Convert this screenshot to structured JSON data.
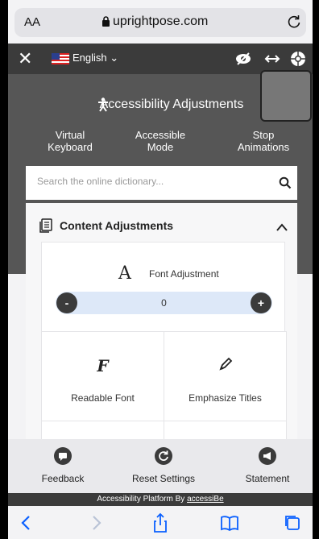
{
  "browser": {
    "text_size_label": "AA",
    "url": "uprightpose.com"
  },
  "widget_header": {
    "language": "English"
  },
  "panel": {
    "title": "Accessibility Adjustments",
    "quick_actions": [
      {
        "label": "Virtual Keyboard"
      },
      {
        "label": "Accessible Mode"
      },
      {
        "label": "Stop Animations"
      }
    ]
  },
  "search": {
    "placeholder": "Search the online dictionary..."
  },
  "content_adjustments": {
    "title": "Content Adjustments",
    "font_adjustment": {
      "label": "Font Adjustment",
      "value": "0",
      "minus_label": "-",
      "plus_label": "+"
    },
    "cards": [
      {
        "label": "Readable Font",
        "icon": "F-icon"
      },
      {
        "label": "Emphasize Titles",
        "icon": "pencil-icon"
      }
    ]
  },
  "footer": {
    "buttons": [
      {
        "label": "Feedback",
        "icon": "feedback-icon"
      },
      {
        "label": "Reset Settings",
        "icon": "reset-icon"
      },
      {
        "label": "Statement",
        "icon": "megaphone-icon"
      }
    ],
    "platform_prefix": "Accessibility Platform By ",
    "platform_link": "accessiBe"
  },
  "colors": {
    "header": "#3b3b3b",
    "panel": "#565656",
    "stepper": "#dde8f8",
    "ios_blue": "#0a60ff"
  }
}
